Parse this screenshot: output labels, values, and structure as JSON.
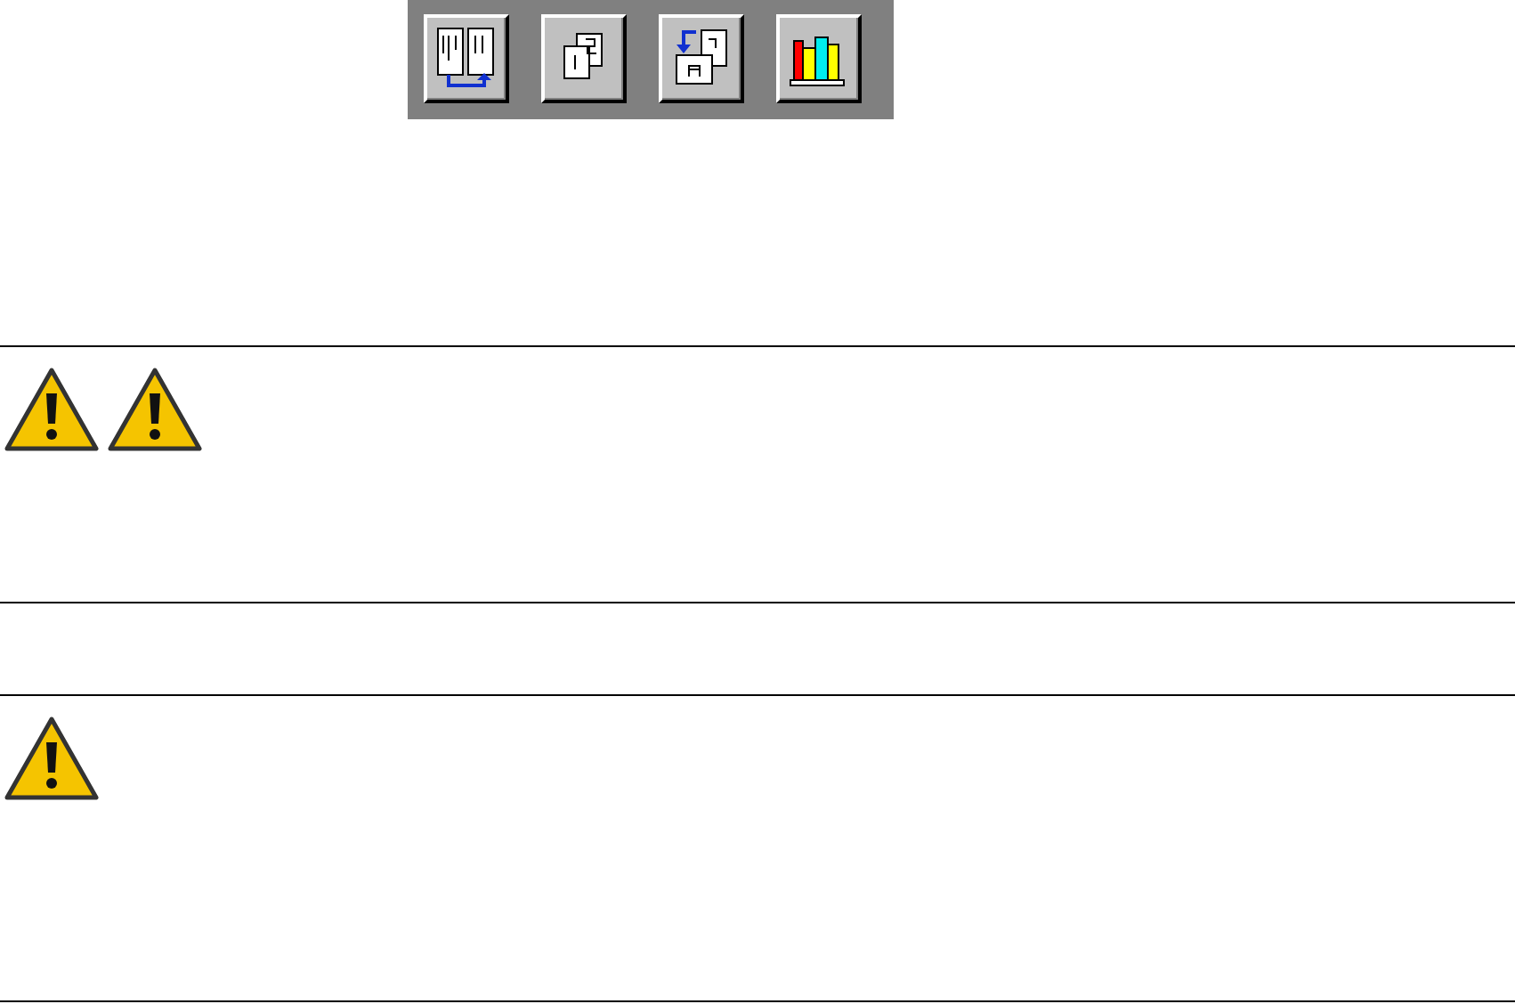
{
  "toolbar": {
    "buttons": [
      {
        "kind": "columns"
      },
      {
        "kind": "pages"
      },
      {
        "kind": "convert"
      },
      {
        "kind": "books"
      }
    ]
  },
  "notes": [
    {
      "kind": "warnings",
      "icons": [
        {
          "kind": "warning"
        },
        {
          "kind": "warning"
        }
      ]
    },
    {
      "kind": "empty"
    },
    {
      "kind": "warnings",
      "icons": [
        {
          "kind": "warning"
        }
      ]
    }
  ]
}
